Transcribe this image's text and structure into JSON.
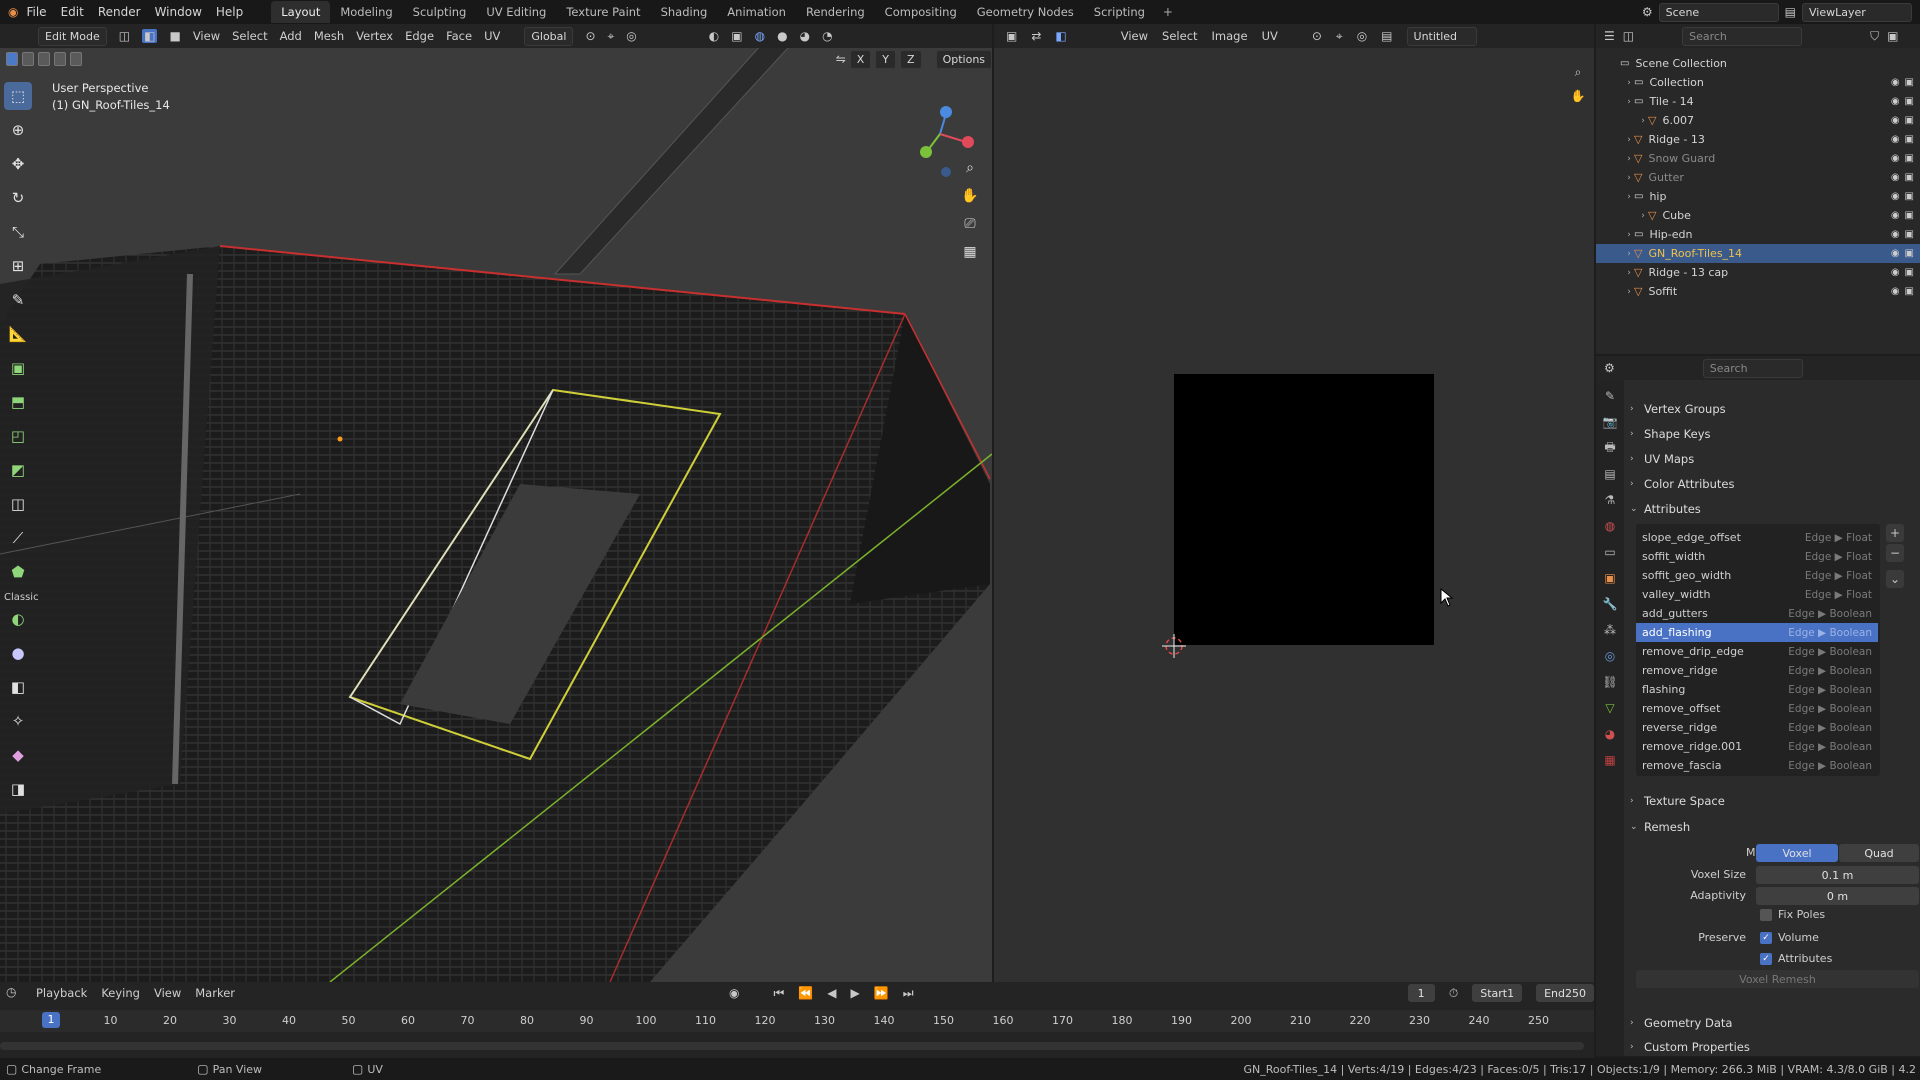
{
  "menubar": {
    "items": [
      "File",
      "Edit",
      "Render",
      "Window",
      "Help"
    ],
    "workspaces": [
      "Layout",
      "Modeling",
      "Sculpting",
      "UV Editing",
      "Texture Paint",
      "Shading",
      "Animation",
      "Rendering",
      "Compositing",
      "Geometry Nodes",
      "Scripting"
    ],
    "active_workspace": "Layout",
    "add_tab": "+",
    "scene": "Scene",
    "view_layer": "ViewLayer"
  },
  "viewport": {
    "mode": "Edit Mode",
    "menus": [
      "View",
      "Select",
      "Add",
      "Mesh",
      "Vertex",
      "Edge",
      "Face",
      "UV"
    ],
    "transform_orientation": "Global",
    "axes": [
      "X",
      "Y",
      "Z"
    ],
    "options_label": "Options",
    "perspective_label": "User Perspective",
    "object_label": "(1) GN_Roof-Tiles_14",
    "tool_classic_label": "Classic"
  },
  "image_editor": {
    "menus": [
      "View",
      "Select",
      "Image",
      "UV"
    ],
    "image_name": "Untitled"
  },
  "outliner": {
    "search_placeholder": "Search",
    "rows": [
      {
        "name": "Scene Collection",
        "kind": "scene",
        "indent": 0,
        "state": "normal"
      },
      {
        "name": "Collection",
        "kind": "collection",
        "indent": 1,
        "state": "normal"
      },
      {
        "name": "Tile - 14",
        "kind": "collection",
        "indent": 1,
        "state": "normal"
      },
      {
        "name": "6.007",
        "kind": "object",
        "indent": 2,
        "state": "normal"
      },
      {
        "name": "Ridge - 13",
        "kind": "object",
        "indent": 1,
        "state": "normal"
      },
      {
        "name": "Snow Guard",
        "kind": "object",
        "indent": 1,
        "state": "dim"
      },
      {
        "name": "Gutter",
        "kind": "object",
        "indent": 1,
        "state": "dim"
      },
      {
        "name": "hip",
        "kind": "collection",
        "indent": 1,
        "state": "normal"
      },
      {
        "name": "Cube",
        "kind": "object",
        "indent": 2,
        "state": "normal"
      },
      {
        "name": "Hip-edn",
        "kind": "collection",
        "indent": 1,
        "state": "normal"
      },
      {
        "name": "GN_Roof-Tiles_14",
        "kind": "object",
        "indent": 1,
        "state": "selected"
      },
      {
        "name": "Ridge - 13 cap",
        "kind": "object",
        "indent": 1,
        "state": "normal"
      },
      {
        "name": "Soffit",
        "kind": "object",
        "indent": 1,
        "state": "normal"
      }
    ]
  },
  "properties": {
    "search_placeholder": "Search",
    "sections_top": [
      "Vertex Groups",
      "Shape Keys",
      "UV Maps",
      "Color Attributes",
      "Attributes"
    ],
    "attributes": [
      {
        "name": "slope_edge_offset",
        "domain": "Edge",
        "type": "Float",
        "selected": false
      },
      {
        "name": "soffit_width",
        "domain": "Edge",
        "type": "Float",
        "selected": false
      },
      {
        "name": "soffit_geo_width",
        "domain": "Edge",
        "type": "Float",
        "selected": false
      },
      {
        "name": "valley_width",
        "domain": "Edge",
        "type": "Float",
        "selected": false
      },
      {
        "name": "add_gutters",
        "domain": "Edge",
        "type": "Boolean",
        "selected": false
      },
      {
        "name": "add_flashing",
        "domain": "Edge",
        "type": "Boolean",
        "selected": true
      },
      {
        "name": "remove_drip_edge",
        "domain": "Edge",
        "type": "Boolean",
        "selected": false
      },
      {
        "name": "remove_ridge",
        "domain": "Edge",
        "type": "Boolean",
        "selected": false
      },
      {
        "name": "flashing",
        "domain": "Edge",
        "type": "Boolean",
        "selected": false
      },
      {
        "name": "remove_offset",
        "domain": "Edge",
        "type": "Boolean",
        "selected": false
      },
      {
        "name": "reverse_ridge",
        "domain": "Edge",
        "type": "Boolean",
        "selected": false
      },
      {
        "name": "remove_ridge.001",
        "domain": "Edge",
        "type": "Boolean",
        "selected": false
      },
      {
        "name": "remove_fascia",
        "domain": "Edge",
        "type": "Boolean",
        "selected": false
      }
    ],
    "texture_space": "Texture Space",
    "remesh": {
      "title": "Remesh",
      "mode_label": "Mode",
      "modes": [
        "Voxel",
        "Quad"
      ],
      "active_mode": "Voxel",
      "voxel_size_label": "Voxel Size",
      "voxel_size": "0.1 m",
      "adaptivity_label": "Adaptivity",
      "adaptivity": "0 m",
      "fix_poles": "Fix Poles",
      "preserve_label": "Preserve",
      "volume": "Volume",
      "attributes": "Attributes",
      "button": "Voxel Remesh"
    },
    "sections_bottom": [
      "Geometry Data",
      "Custom Properties"
    ]
  },
  "timeline": {
    "menus": [
      "Playback",
      "Keying",
      "View",
      "Marker"
    ],
    "current_frame": "1",
    "start_label": "Start",
    "start": "1",
    "end_label": "End",
    "end": "250",
    "ticks": [
      "1",
      "10",
      "20",
      "30",
      "40",
      "50",
      "60",
      "70",
      "80",
      "90",
      "100",
      "110",
      "120",
      "130",
      "140",
      "150",
      "160",
      "170",
      "180",
      "190",
      "200",
      "210",
      "220",
      "230",
      "240",
      "250"
    ]
  },
  "statusbar": {
    "left": "Change Frame",
    "middle": "Pan View",
    "uv": "UV",
    "stats": "GN_Roof-Tiles_14 | Verts:4/19 | Edges:4/23 | Faces:0/5 | Tris:17 | Objects:1/9 | Memory: 266.3 MiB | VRAM: 4.3/8.0 GiB | 4.2"
  },
  "colors": {
    "accent": "#4a72c4",
    "selected_text": "#f0c04a",
    "object_icon": "#e8904a"
  }
}
